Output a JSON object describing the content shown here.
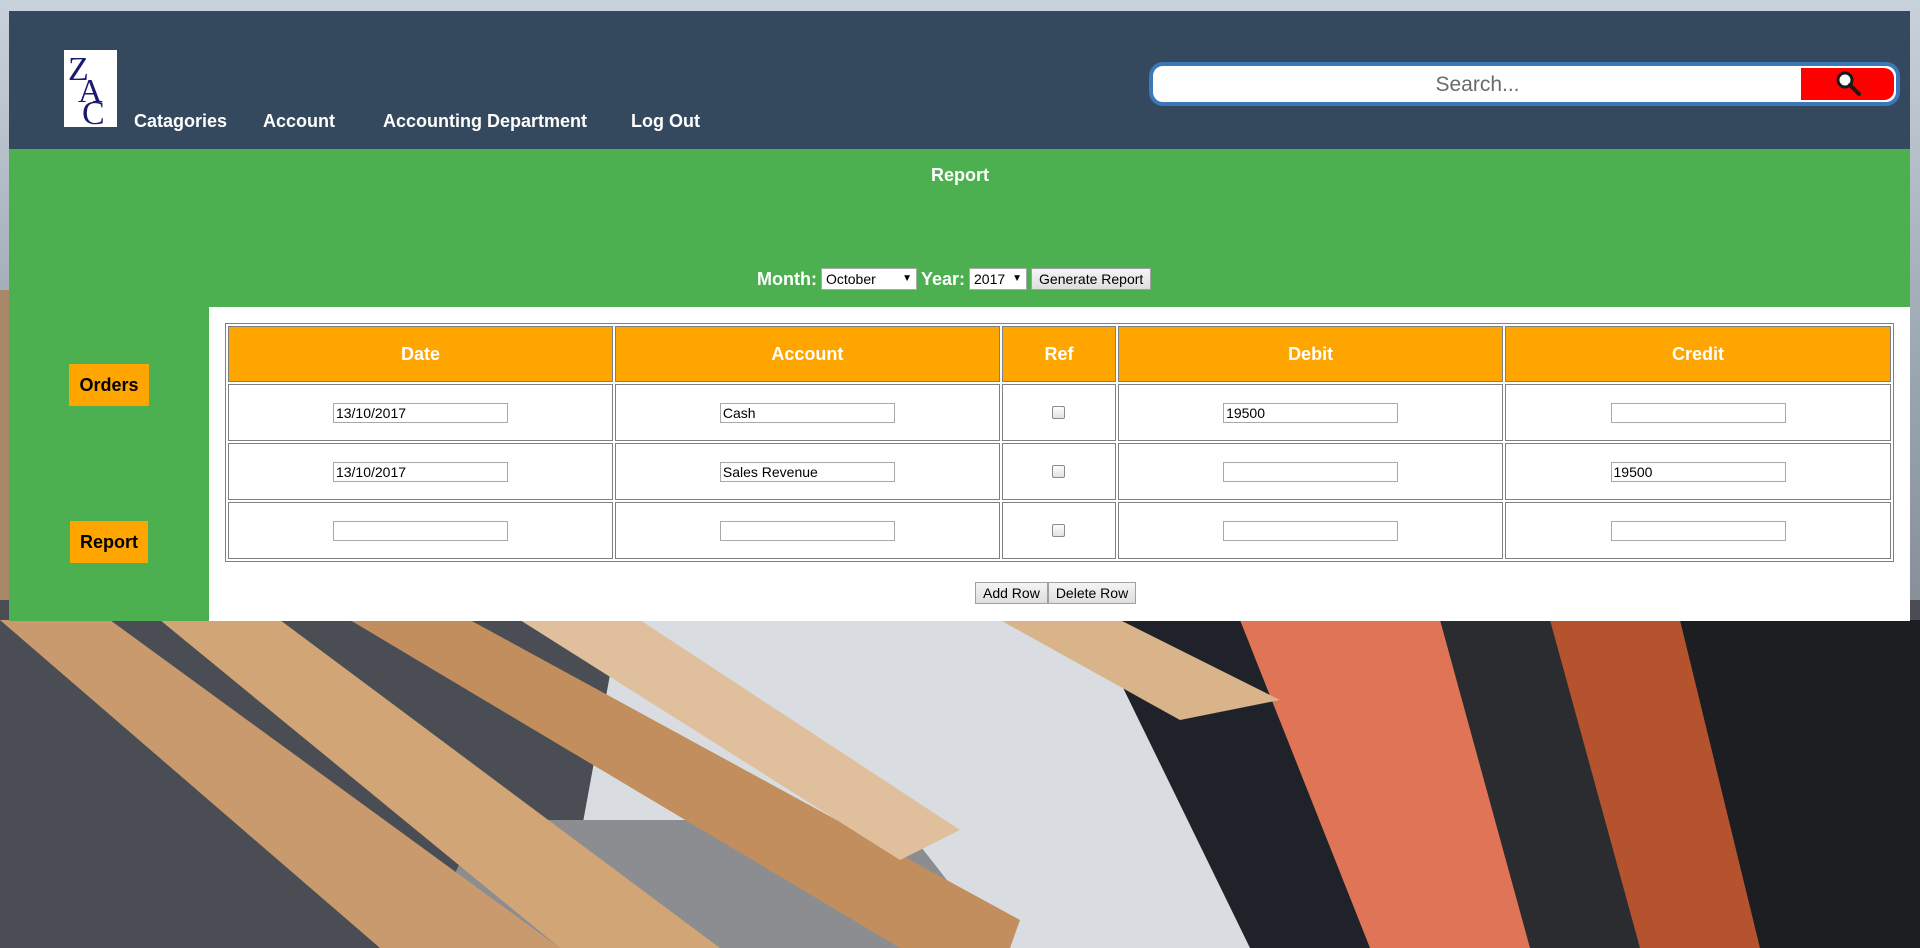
{
  "header": {
    "logo_text": "ZAC",
    "nav": [
      {
        "label": "Catagories"
      },
      {
        "label": "Account"
      },
      {
        "label": "Accounting Department"
      },
      {
        "label": "Log Out"
      }
    ],
    "search": {
      "placeholder": "Search...",
      "button_icon": "search-icon"
    }
  },
  "report": {
    "title": "Report",
    "month_label": "Month:",
    "month_value": "October",
    "year_label": "Year:",
    "year_value": "2017",
    "generate_label": "Generate Report"
  },
  "sidebar": {
    "items": [
      {
        "label": "Orders"
      },
      {
        "label": "Report"
      }
    ]
  },
  "table": {
    "columns": [
      "Date",
      "Account",
      "Ref",
      "Debit",
      "Credit"
    ],
    "rows": [
      {
        "date": "13/10/2017",
        "account": "Cash",
        "ref": false,
        "debit": "19500",
        "credit": ""
      },
      {
        "date": "13/10/2017",
        "account": "Sales Revenue",
        "ref": false,
        "debit": "",
        "credit": "19500"
      },
      {
        "date": "",
        "account": "",
        "ref": false,
        "debit": "",
        "credit": ""
      }
    ]
  },
  "actions": {
    "add_row_label": "Add Row",
    "delete_row_label": "Delete Row"
  },
  "colors": {
    "header_bg": "#34495e",
    "green_bg": "#4caf50",
    "orange": "#ffa500",
    "search_button": "#ff0000",
    "search_border": "#3a78b8"
  }
}
